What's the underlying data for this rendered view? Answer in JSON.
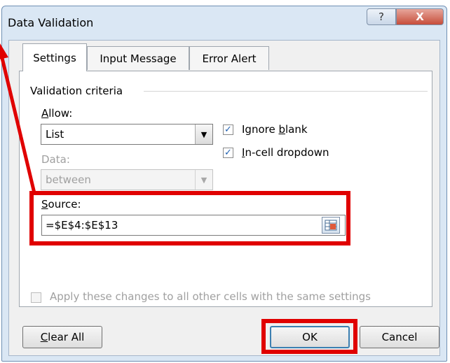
{
  "dialog": {
    "title": "Data Validation",
    "help_label": "?",
    "close_label": "X"
  },
  "tabs": [
    {
      "label": "Settings",
      "active": true
    },
    {
      "label": "Input Message",
      "active": false
    },
    {
      "label": "Error Alert",
      "active": false
    }
  ],
  "settings": {
    "group_label": "Validation criteria",
    "allow": {
      "label": "Allow:",
      "value": "List"
    },
    "data": {
      "label": "Data:",
      "value": "between"
    },
    "ignore_blank": {
      "label": "Ignore blank",
      "checked": true
    },
    "in_cell_dropdown": {
      "label": "In-cell dropdown",
      "checked": true
    },
    "source": {
      "label": "Source:",
      "value": "=$E$4:$E$13"
    },
    "apply_all": {
      "label": "Apply these changes to all other cells with the same settings",
      "checked": false
    }
  },
  "buttons": {
    "clear_all": "Clear All",
    "ok": "OK",
    "cancel": "Cancel"
  },
  "icons": {
    "dropdown_arrow": "▼",
    "checkmark": "✓"
  },
  "colors": {
    "highlight": "#e00000",
    "title_bg": "#dae7f4",
    "close_button": "#c74d3a"
  }
}
